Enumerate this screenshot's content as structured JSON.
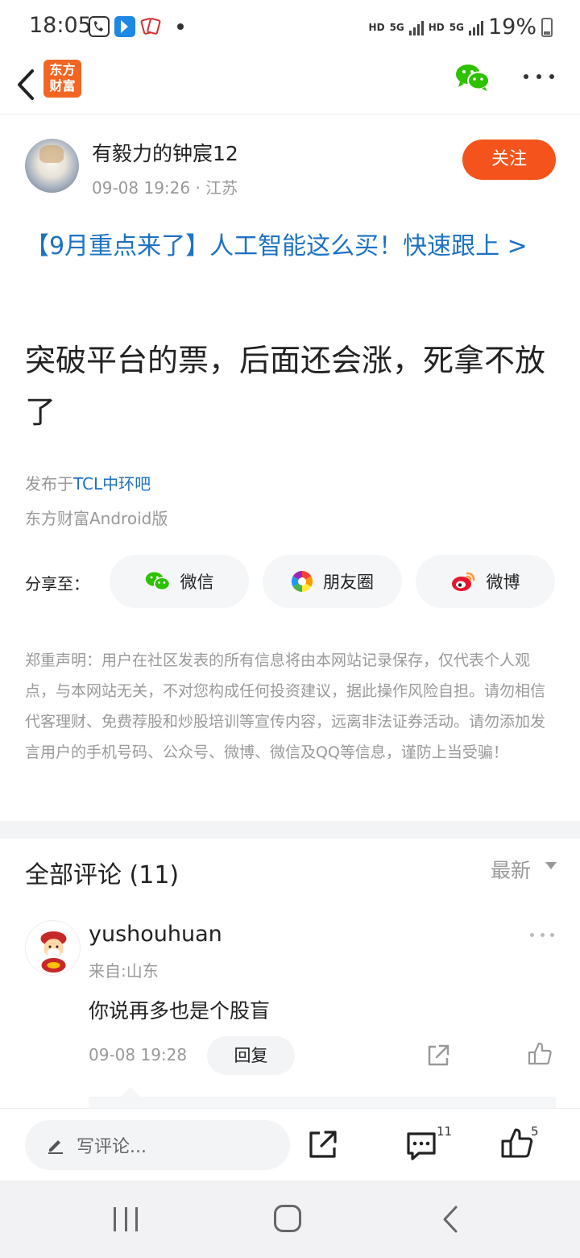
{
  "status_bar": {
    "time": "18:05",
    "net1": "HD",
    "net1_type": "5G",
    "net2": "HD",
    "net2_type": "5G",
    "battery": "19%"
  },
  "header": {
    "logo_line1": "东方",
    "logo_line2": "财富",
    "brand_color": "#f26522"
  },
  "post": {
    "author": "有毅力的钟宸12",
    "meta": "09-08 19:26 · 江苏",
    "follow_label": "关注",
    "promo_link": "【9月重点来了】人工智能这么买！快速跟上 >",
    "content": "突破平台的票，后面还会涨，死拿不放了",
    "source_prefix": "发布于",
    "source_bar": "TCL中环吧",
    "client": "东方财富Android版"
  },
  "share": {
    "label": "分享至：",
    "wechat": "微信",
    "moments": "朋友圈",
    "weibo": "微博"
  },
  "disclaimer": "郑重声明：用户在社区发表的所有信息将由本网站记录保存，仅代表个人观点，与本网站无关，不对您构成任何投资建议，据此操作风险自担。请勿相信代客理财、免费荐股和炒股培训等宣传内容，远离非法证券活动。请勿添加发言用户的手机号码、公众号、微博、微信及QQ等信息，谨防上当受骗！",
  "comments": {
    "title": "全部评论",
    "count": "(11)",
    "sort": "最新",
    "items": [
      {
        "user": "yushouhuan",
        "location": "来自:山东",
        "text": "你说再多也是个股盲",
        "time": "09-08 19:28",
        "reply_label": "回复"
      }
    ]
  },
  "bottom_bar": {
    "input_placeholder": "写评论...",
    "comment_count": "11",
    "like_count": "5"
  },
  "colors": {
    "accent": "#f4541b",
    "link": "#1d72c2"
  }
}
